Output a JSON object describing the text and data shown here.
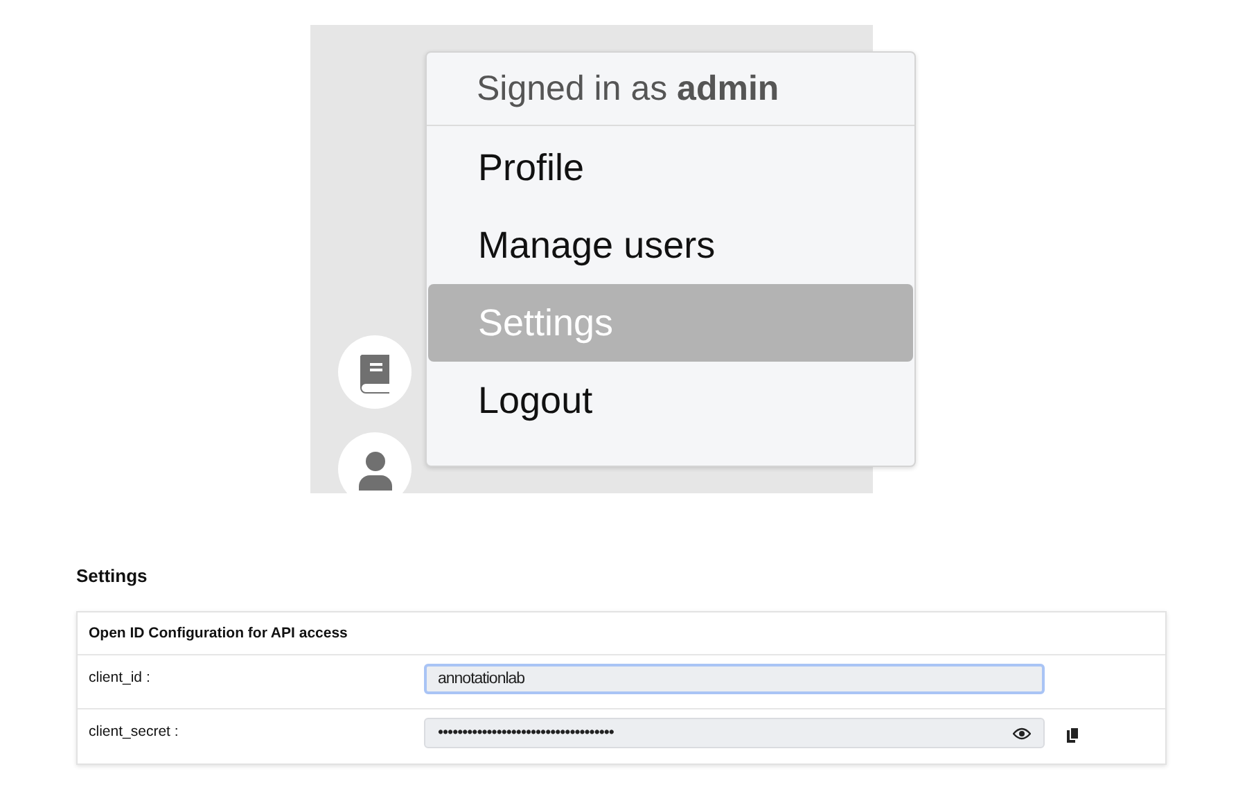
{
  "user_menu": {
    "header": "Signed in as **admin**",
    "items": [
      {
        "label": "Profile",
        "selected": false
      },
      {
        "label": "Manage users",
        "selected": false
      },
      {
        "label": "Settings",
        "selected": true
      },
      {
        "label": "Logout",
        "selected": false
      }
    ]
  },
  "settings": {
    "title": "Settings",
    "card_title": "Open ID Configuration for API access",
    "fields": [
      {
        "kind": "text",
        "label": "client_id :",
        "value": "annotationlab",
        "focused": true
      },
      {
        "kind": "secret",
        "label": "client_secret :",
        "value": "••••••••••••••••••••••••••••••••••••",
        "focused": false
      }
    ]
  }
}
